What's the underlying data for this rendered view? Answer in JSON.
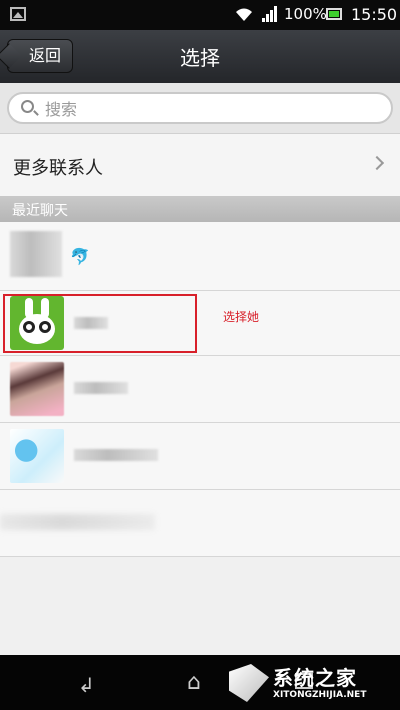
{
  "status_bar": {
    "battery": "100%",
    "time": "15:50"
  },
  "header": {
    "back_label": "返回",
    "title": "选择"
  },
  "search": {
    "placeholder": "搜索"
  },
  "more_contacts": {
    "label": "更多联系人"
  },
  "section": {
    "title": "最近聊天"
  },
  "annotation": {
    "text": "选择她"
  },
  "colors": {
    "highlight": "#d8202a",
    "titlebar": "#2e3035",
    "avatar_green": "#62b62f"
  },
  "icons": [
    "image-icon",
    "wifi-icon",
    "signal-icon",
    "battery-icon",
    "search-icon",
    "chevron-right-icon",
    "dolphin-icon",
    "back-nav-icon",
    "home-icon",
    "recent-apps-icon"
  ]
}
